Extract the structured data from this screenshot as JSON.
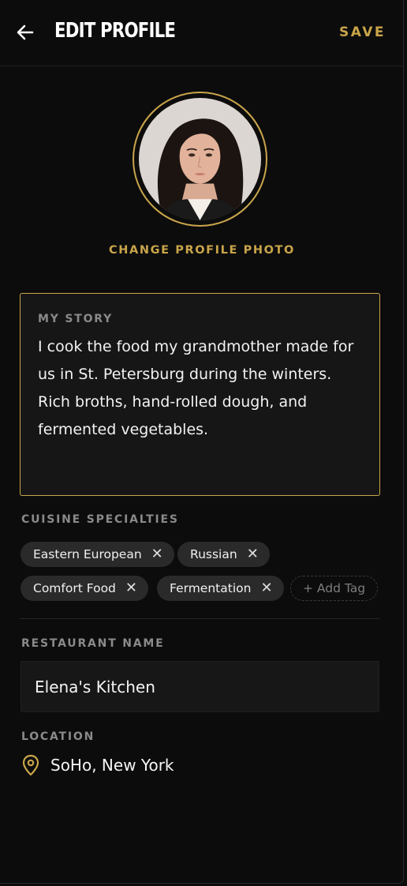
{
  "header": {
    "back_icon": "arrow-left-icon",
    "title": "EDIT PROFILE",
    "save_label": "SAVE"
  },
  "profile": {
    "change_photo_label": "CHANGE PROFILE PHOTO"
  },
  "story": {
    "label": "MY STORY",
    "text": "I cook the food my grandmother made for us in St. Petersburg during the winters. Rich broths, hand-rolled dough, and fermented vegetables."
  },
  "cuisine": {
    "label": "CUISINE SPECIALTIES",
    "tags": [
      "Eastern European",
      "Russian",
      "Comfort Food",
      "Fermentation"
    ],
    "remove_icon": "close-icon",
    "add_tag_label": "+ Add Tag"
  },
  "restaurant": {
    "label": "RESTAURANT NAME",
    "value": "Elena's Kitchen"
  },
  "location": {
    "label": "LOCATION",
    "icon": "map-pin-icon",
    "value": "SoHo, New York"
  },
  "colors": {
    "accent": "#c9a54a",
    "background": "#0c0c0c",
    "surface": "#161616",
    "tag_bg": "#2a2a2a",
    "label_gray": "#8a8a8a"
  }
}
